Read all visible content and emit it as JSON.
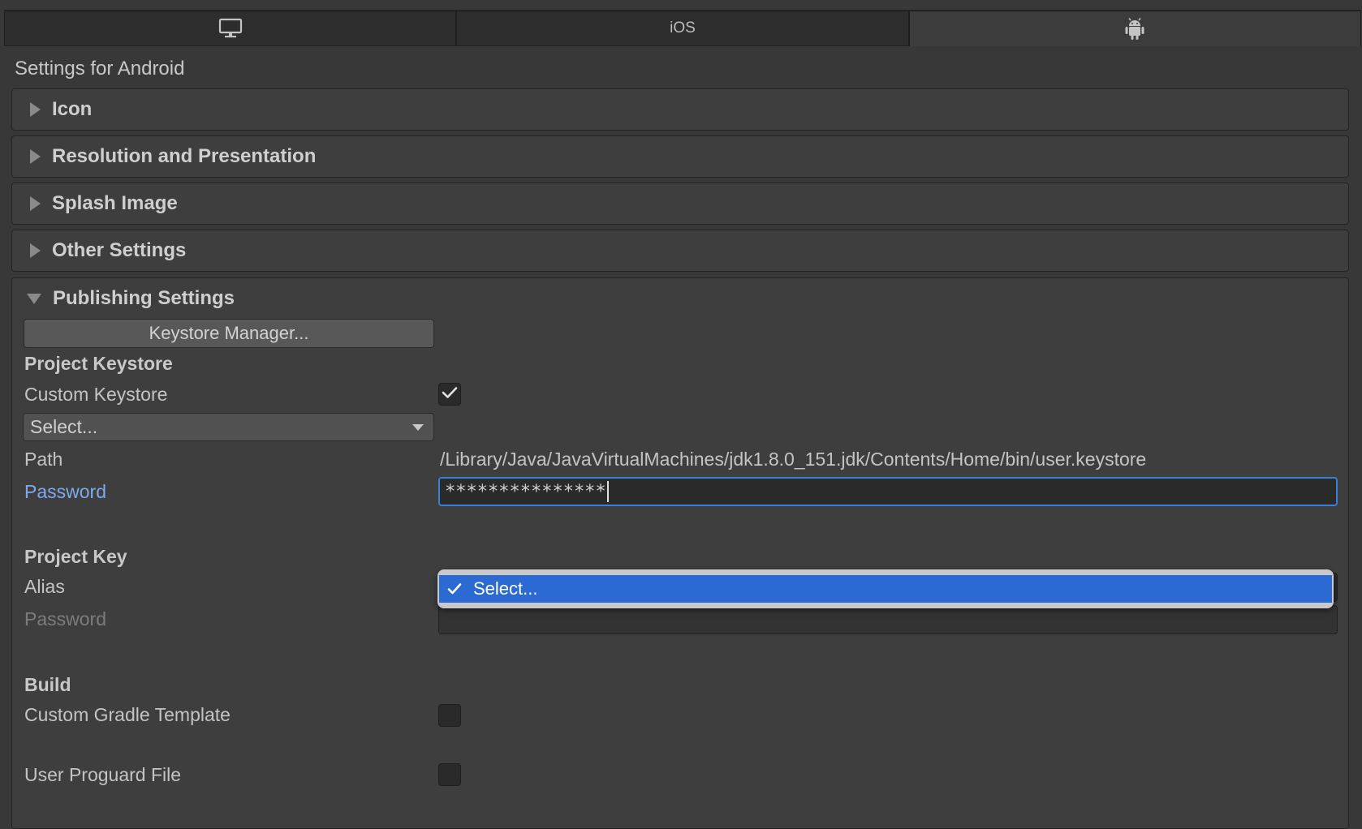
{
  "tabs": [
    {
      "label": "",
      "icon": "desktop-icon",
      "active": false
    },
    {
      "label": "iOS",
      "icon": "",
      "active": false
    },
    {
      "label": "",
      "icon": "android-icon",
      "active": true
    }
  ],
  "settings_title": "Settings for Android",
  "foldouts": [
    {
      "label": "Icon",
      "expanded": false
    },
    {
      "label": "Resolution and Presentation",
      "expanded": false
    },
    {
      "label": "Splash Image",
      "expanded": false
    },
    {
      "label": "Other Settings",
      "expanded": false
    }
  ],
  "publishing": {
    "label": "Publishing Settings",
    "expanded": true,
    "keystore_manager_label": "Keystore Manager...",
    "project_keystore": {
      "heading": "Project Keystore",
      "custom_keystore_label": "Custom Keystore",
      "custom_keystore_checked": true,
      "select_value": "Select...",
      "path_label": "Path",
      "path_value": "/Library/Java/JavaVirtualMachines/jdk1.8.0_151.jdk/Contents/Home/bin/user.keystore",
      "password_label": "Password",
      "password_value": "***************"
    },
    "project_key": {
      "heading": "Project Key",
      "alias_label": "Alias",
      "alias_popup_option": "Select...",
      "password_label": "Password",
      "password_value": ""
    },
    "build": {
      "heading": "Build",
      "custom_gradle_label": "Custom Gradle Template",
      "custom_gradle_checked": false,
      "user_proguard_label": "User Proguard File",
      "user_proguard_checked": false
    }
  },
  "colors": {
    "background": "#383838",
    "accent": "#2c6ad3",
    "focus_label": "#7fa9ef"
  }
}
